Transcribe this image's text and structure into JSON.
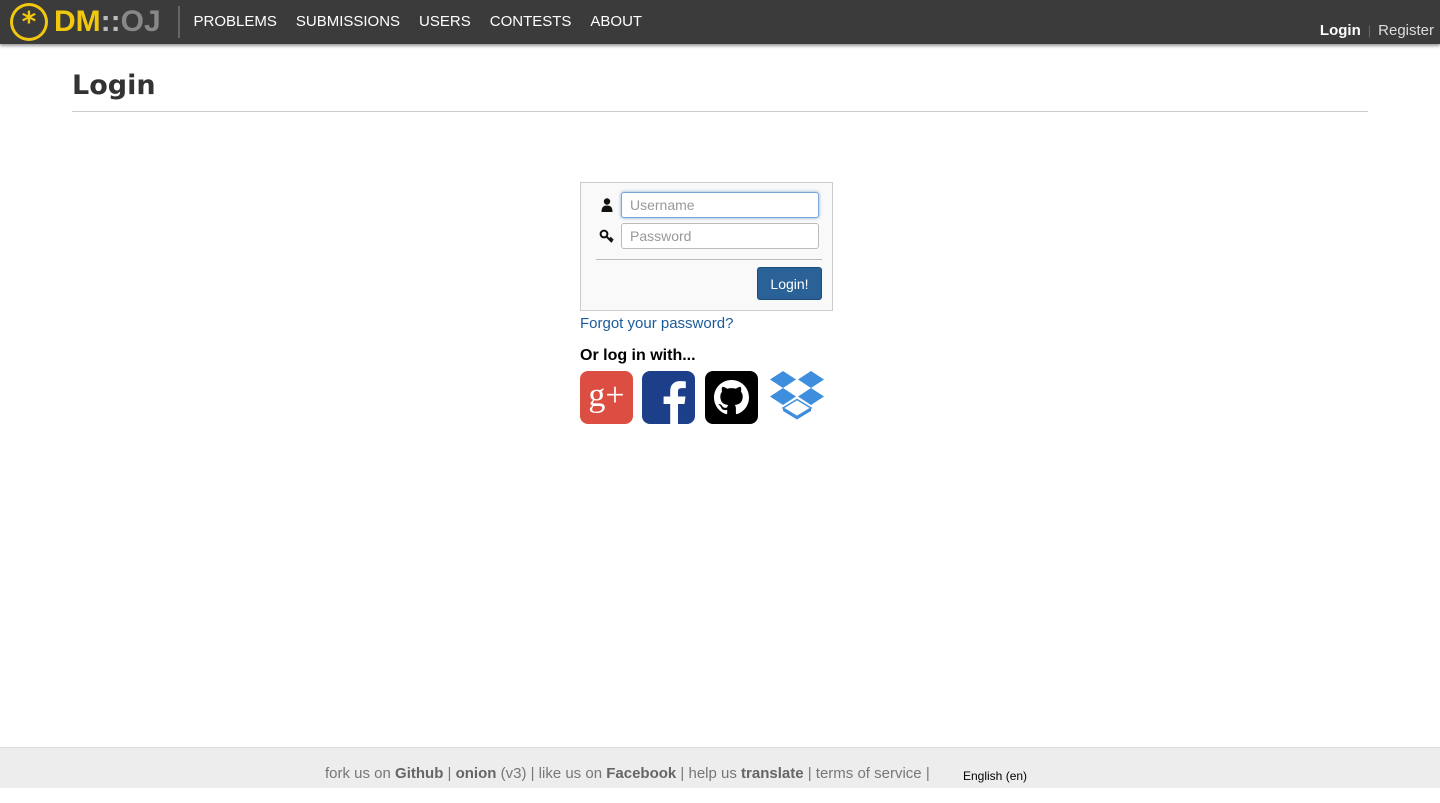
{
  "navbar": {
    "logo": {
      "dm": "DM",
      "sep": "::",
      "oj": "OJ"
    },
    "links": [
      "PROBLEMS",
      "SUBMISSIONS",
      "USERS",
      "CONTESTS",
      "ABOUT"
    ],
    "login_label": "Login",
    "register_label": "Register",
    "background": "#3b3b3b",
    "accent": "#f2c80f"
  },
  "page": {
    "title": "Login"
  },
  "login_form": {
    "username_placeholder": "Username",
    "username_value": "",
    "password_placeholder": "Password",
    "password_value": "",
    "submit_label": "Login!",
    "forgot_label": "Forgot your password?",
    "or_login_label": "Or log in with...",
    "button_color": "#2a6297"
  },
  "social_logins": [
    {
      "name": "google-plus",
      "label": "g+",
      "color": "#dc4e41"
    },
    {
      "name": "facebook",
      "label": "f",
      "color": "#1d3f8a"
    },
    {
      "name": "github",
      "color": "#000000"
    },
    {
      "name": "dropbox",
      "color": "#3d8fdd"
    }
  ],
  "footer": {
    "fork_prefix": "fork us on ",
    "github": "Github",
    "sep1": " | ",
    "onion": "onion",
    "version": " (v3)",
    "sep2": " | like us on ",
    "facebook": "Facebook",
    "sep3": " | help us ",
    "translate": "translate",
    "sep4": " | ",
    "terms": "terms of service",
    "sep5": " |",
    "language": "English (en)"
  }
}
